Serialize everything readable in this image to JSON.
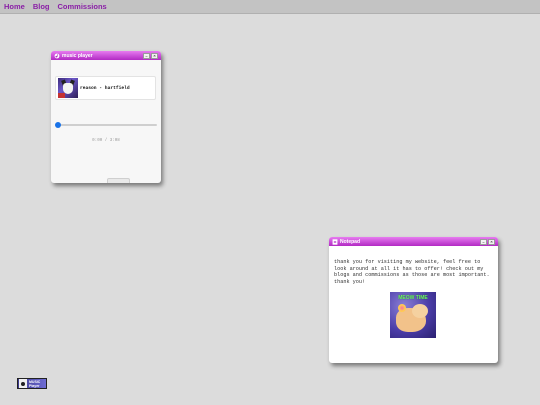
{
  "nav": {
    "items": [
      "Home",
      "Blog",
      "Commissions"
    ]
  },
  "music_player": {
    "title": "music player",
    "minimize_glyph": "–",
    "close_glyph": "×",
    "track": "reason - hartfield",
    "time": "0:00 / 3:08",
    "progress": 0
  },
  "notepad": {
    "title": "Notepad",
    "minimize_glyph": "–",
    "close_glyph": "×",
    "text": "thank you for visiting my website, feel free to look around at all it has to offer! check out my blogs and commissions as those are most important. thank you!",
    "image_caption": "MEOW TIME"
  },
  "badge": {
    "line1": "MUSIC",
    "line2": "Player"
  },
  "colors": {
    "accent": "#b22bc4",
    "nav_link": "#8a1fa6",
    "slider": "#1a73e8"
  }
}
